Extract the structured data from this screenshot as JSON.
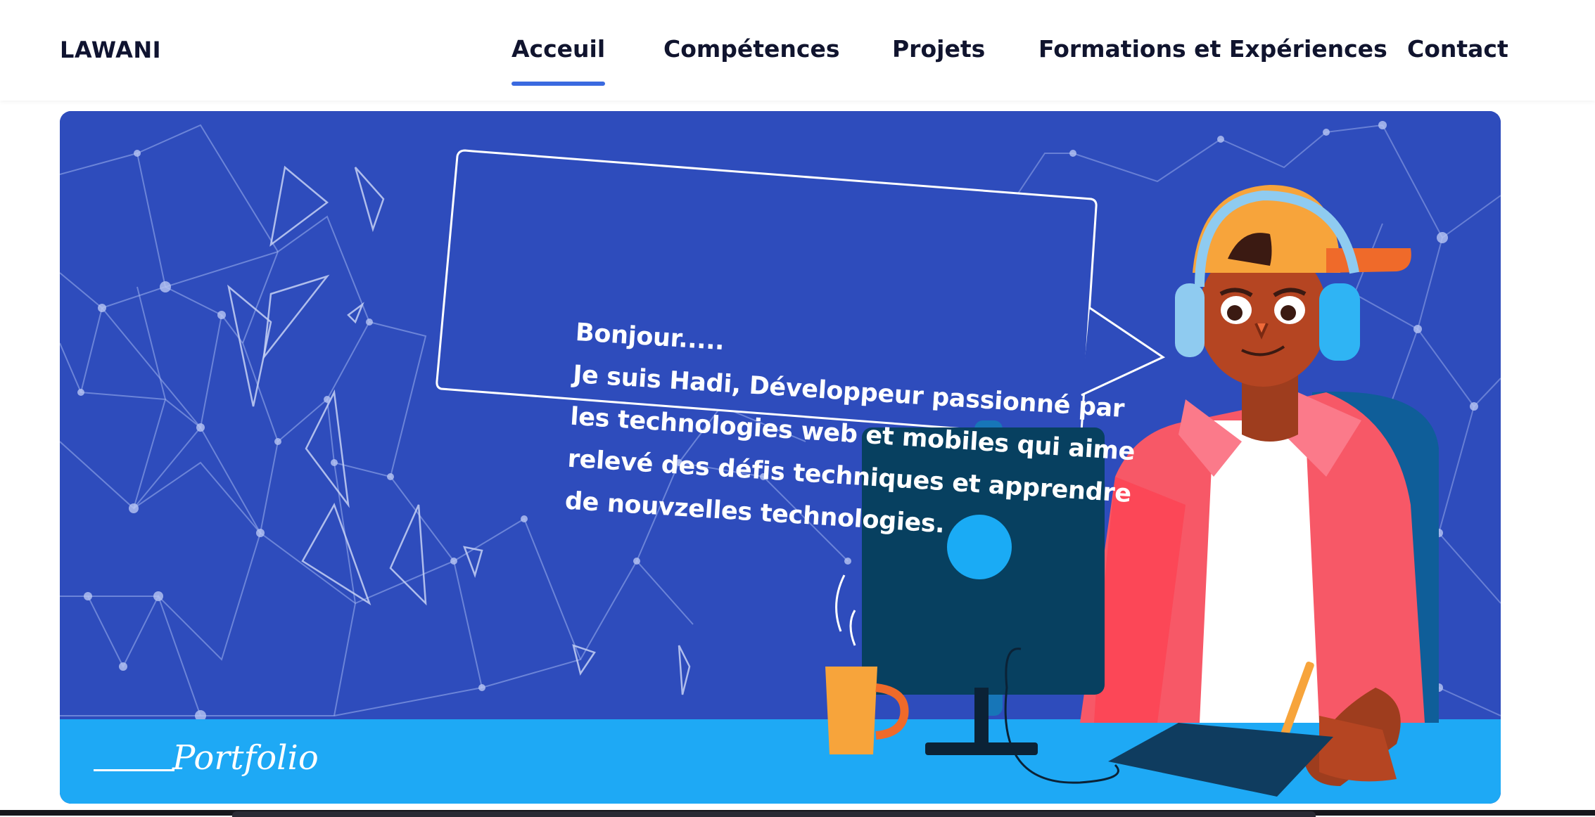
{
  "brand": "LAWANI",
  "nav": {
    "items": [
      {
        "label": "Acceuil",
        "active": true
      },
      {
        "label": "Compétences",
        "active": false
      },
      {
        "label": "Projets",
        "active": false
      },
      {
        "label": "Formations et Expériences",
        "active": false
      },
      {
        "label": "Contact",
        "active": false
      }
    ]
  },
  "hero": {
    "greeting": "Bonjour.....",
    "intro": "Je suis Hadi, Développeur passionné par les technologies web et mobiles qui aime relevé des défis techniques et apprendre de nouvzelles technologies.",
    "portfolio_label": "Portfolio"
  },
  "colors": {
    "hero_background": "#2e4cbc",
    "desk": "#1ea9f5",
    "accent_underline": "#3a6ae0",
    "monitor": "#074060",
    "jacket": "#f75867",
    "cap": "#f7a43b"
  }
}
